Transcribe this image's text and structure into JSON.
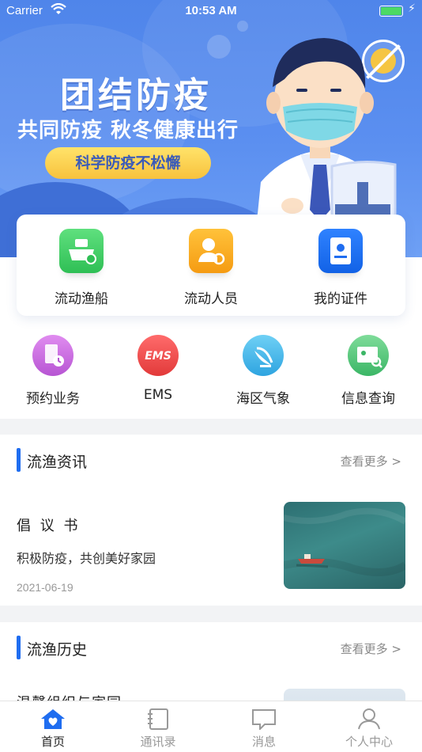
{
  "status_bar": {
    "carrier": "Carrier",
    "time": "10:53 AM"
  },
  "banner": {
    "title": "团结防疫",
    "subtitle": "共同防疫 秋冬健康出行",
    "pill": "科学防疫不松懈"
  },
  "quick_actions": [
    {
      "label": "流动渔船",
      "icon": "fishing-boat-icon",
      "color": "#34c759"
    },
    {
      "label": "流动人员",
      "icon": "person-sync-icon",
      "color": "#f5a623"
    },
    {
      "label": "我的证件",
      "icon": "certificate-icon",
      "color": "#1f6df0"
    }
  ],
  "services": [
    {
      "label": "预约业务",
      "icon": "appointment-icon",
      "color": "#c56ad8"
    },
    {
      "label": "EMS",
      "icon": "ems-icon",
      "color": "#ef4b4b"
    },
    {
      "label": "海区气象",
      "icon": "satellite-dish-icon",
      "color": "#3ab4e8"
    },
    {
      "label": "信息查询",
      "icon": "info-search-icon",
      "color": "#4bbf73"
    }
  ],
  "news_section": {
    "title": "流渔资讯",
    "more": "查看更多 >",
    "item": {
      "title": "倡 议 书",
      "subtitle": "积极防疫，共创美好家园",
      "date": "2021-06-19"
    }
  },
  "history_section": {
    "title": "流渔历史",
    "more": "查看更多 >",
    "item": {
      "title": "温馨组织与家园"
    }
  },
  "tabbar": [
    {
      "label": "首页",
      "icon": "home-heart-icon",
      "active": true
    },
    {
      "label": "通讯录",
      "icon": "contacts-icon",
      "active": false
    },
    {
      "label": "消息",
      "icon": "message-icon",
      "active": false
    },
    {
      "label": "个人中心",
      "icon": "person-icon",
      "active": false
    }
  ],
  "colors": {
    "accent": "#1f6df0",
    "banner": "#5b8ff0"
  }
}
